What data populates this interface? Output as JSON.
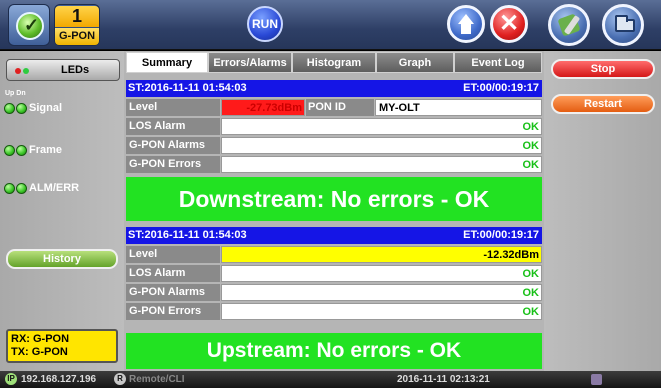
{
  "header": {
    "port_number": "1",
    "port_name": "G-PON",
    "run_label": "RUN",
    "close_glyph": "✕"
  },
  "icons": {
    "app": "meter-check-icon",
    "home": "home-icon",
    "close": "close-icon",
    "tools": "tools-icon",
    "folder": "folder-icon",
    "ip": "ip-icon",
    "remote": "remote-icon"
  },
  "left": {
    "leds_label": "LEDs",
    "updn": "Up Dn",
    "led_items": [
      "Signal",
      "Frame",
      "ALM/ERR"
    ],
    "history_label": "History",
    "rx": "RX: G-PON",
    "tx": "TX: G-PON"
  },
  "tabs": [
    "Summary",
    "Errors/Alarms",
    "Histogram",
    "Graph",
    "Event Log"
  ],
  "active_tab": "Summary",
  "downstream": {
    "start": "ST:2016-11-11 01:54:03",
    "elapsed": "ET:00/00:19:17",
    "level_label": "Level",
    "level_value": "-27.73dBm",
    "pon_id_label": "PON ID",
    "pon_id_value": "MY-OLT",
    "los_label": "LOS Alarm",
    "los_value": "OK",
    "alarms_label": "G-PON Alarms",
    "alarms_value": "OK",
    "errors_label": "G-PON Errors",
    "errors_value": "OK",
    "banner": "Downstream: No errors - OK"
  },
  "upstream": {
    "start": "ST:2016-11-11 01:54:03",
    "elapsed": "ET:00/00:19:17",
    "level_label": "Level",
    "level_value": "-12.32dBm",
    "los_label": "LOS Alarm",
    "los_value": "OK",
    "alarms_label": "G-PON Alarms",
    "alarms_value": "OK",
    "errors_label": "G-PON Errors",
    "errors_value": "OK",
    "banner": "Upstream: No errors - OK"
  },
  "right": {
    "stop_label": "Stop",
    "restart_label": "Restart"
  },
  "status": {
    "ip_badge": "IP",
    "ip": "192.168.127.196",
    "remote_badge": "R",
    "remote": "Remote/CLI",
    "clock": "2016-11-11 02:13:21"
  },
  "colors": {
    "ok_green": "#22e222",
    "status_blue": "#1515e6",
    "downstream_level_bg": "#ff1a1a",
    "upstream_level_bg": "#ffff00",
    "stop": "#d41818",
    "restart": "#e45d12",
    "history": "#64a32a",
    "rx_tx_bg": "#ffe500"
  }
}
